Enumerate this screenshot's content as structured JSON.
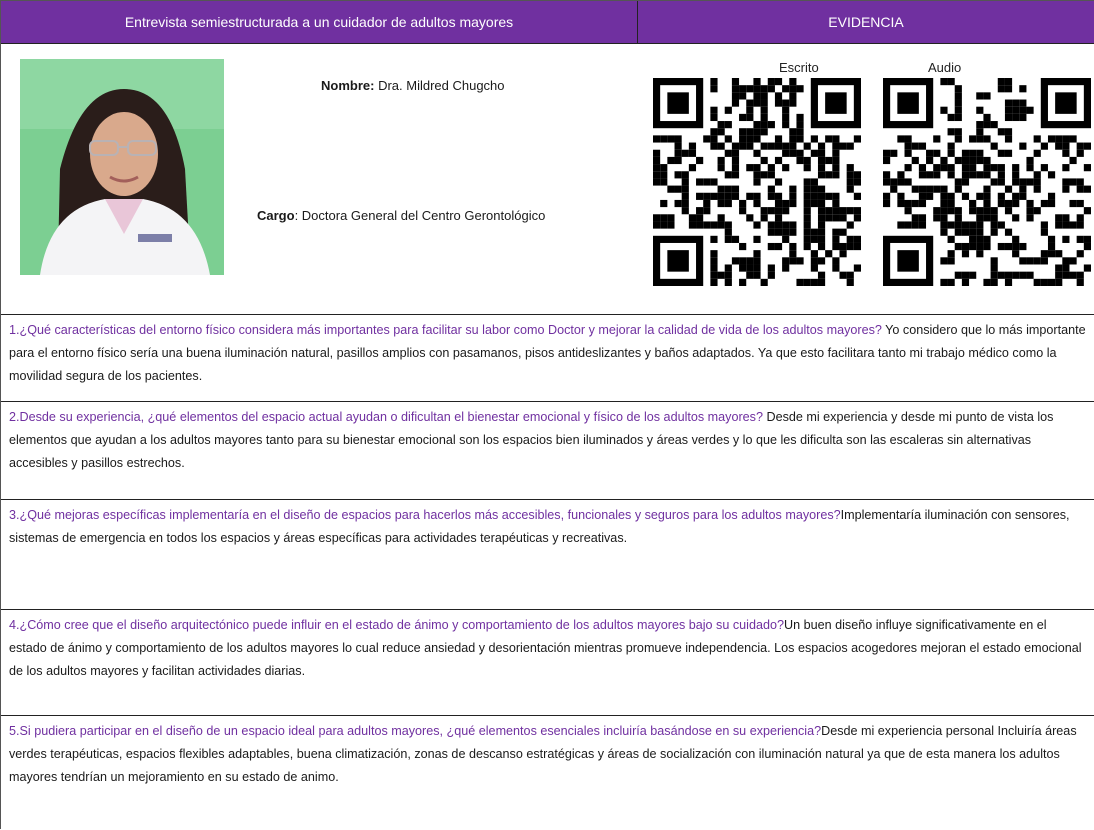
{
  "header": {
    "left_title": "Entrevista semiestructurada a un cuidador de adultos mayores",
    "right_title": "EVIDENCIA"
  },
  "profile": {
    "name_label": "Nombre:",
    "name_value": " Dra. Mildred Chugcho",
    "cargo_label": "Cargo",
    "cargo_value": ": Doctora General del Centro Gerontológico"
  },
  "evidence": {
    "written_label": "Escrito",
    "audio_label": "Audio"
  },
  "qa": [
    {
      "question": "1.¿Qué características del entorno físico considera más importantes para facilitar su labor como Doctor y mejorar la calidad de vida de los adultos mayores?",
      "answer": " Yo considero que lo más importante para el entorno físico sería una buena iluminación natural, pasillos amplios con pasamanos, pisos antideslizantes y baños adaptados. Ya que esto facilitara tanto mi trabajo médico como la movilidad segura de los pacientes."
    },
    {
      "question": "2.Desde su experiencia, ¿qué elementos del espacio actual ayudan o dificultan el bienestar emocional y físico de los adultos mayores?",
      "answer": "        Desde mi experiencia y desde mi punto de vista los elementos que ayudan a los adultos mayores tanto para su bienestar emocional son los espacios bien iluminados y áreas verdes y lo que les dificulta son las escaleras sin alternativas accesibles y pasillos estrechos."
    },
    {
      "question": "3.¿Qué mejoras específicas implementaría en el diseño de espacios para hacerlos más accesibles, funcionales y seguros para los adultos mayores?",
      "answer": "Implementaría iluminación con sensores, sistemas de emergencia en todos los espacios y áreas específicas para actividades terapéuticas y recreativas."
    },
    {
      "question": "4.¿Cómo cree que el diseño arquitectónico puede influir en el estado de ánimo y comportamiento de los adultos mayores bajo su cuidado?",
      "answer": "Un buen diseño influye significativamente en el estado de ánimo y comportamiento de los adultos mayores lo cual reduce ansiedad y desorientación mientras promueve independencia. Los espacios acogedores mejoran el estado emocional de los adultos mayores y facilitan actividades diarias."
    },
    {
      "question": "5.Si pudiera participar en el diseño de un espacio ideal para adultos mayores, ¿qué elementos esenciales incluiría basándose en su experiencia?",
      "answer": "Desde mi experiencia personal Incluiría áreas verdes terapéuticas, espacios flexibles adaptables, buena climatización, zonas de descanso estratégicas y áreas de socialización con iluminación natural ya que de esta manera los adultos mayores tendrían un mejoramiento en su estado de animo."
    }
  ],
  "colors": {
    "header_bg": "#7030a0",
    "question_text": "#7030a0",
    "answer_text": "#1a1a1a"
  }
}
